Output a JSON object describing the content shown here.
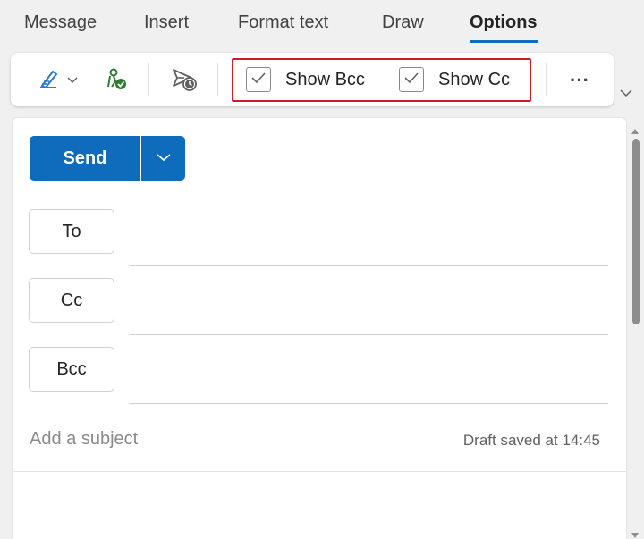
{
  "tabs": [
    {
      "label": "Message",
      "active": false
    },
    {
      "label": "Insert",
      "active": false
    },
    {
      "label": "Format text",
      "active": false
    },
    {
      "label": "Draw",
      "active": false
    },
    {
      "label": "Options",
      "active": true
    }
  ],
  "toolbar": {
    "signature_icon": "signature-icon",
    "permission_icon": "permission-icon",
    "delay_delivery_icon": "delay-delivery-icon",
    "show_bcc": {
      "label": "Show Bcc",
      "checked": true
    },
    "show_cc": {
      "label": "Show Cc",
      "checked": true
    },
    "more_label": "···"
  },
  "compose": {
    "send_label": "Send",
    "to_label": "To",
    "cc_label": "Cc",
    "bcc_label": "Bcc",
    "subject_placeholder": "Add a subject",
    "draft_status": "Draft saved at 14:45"
  },
  "colors": {
    "accent": "#0f6cbd",
    "highlight": "#c8202b",
    "permission_green": "#2e7d32"
  }
}
